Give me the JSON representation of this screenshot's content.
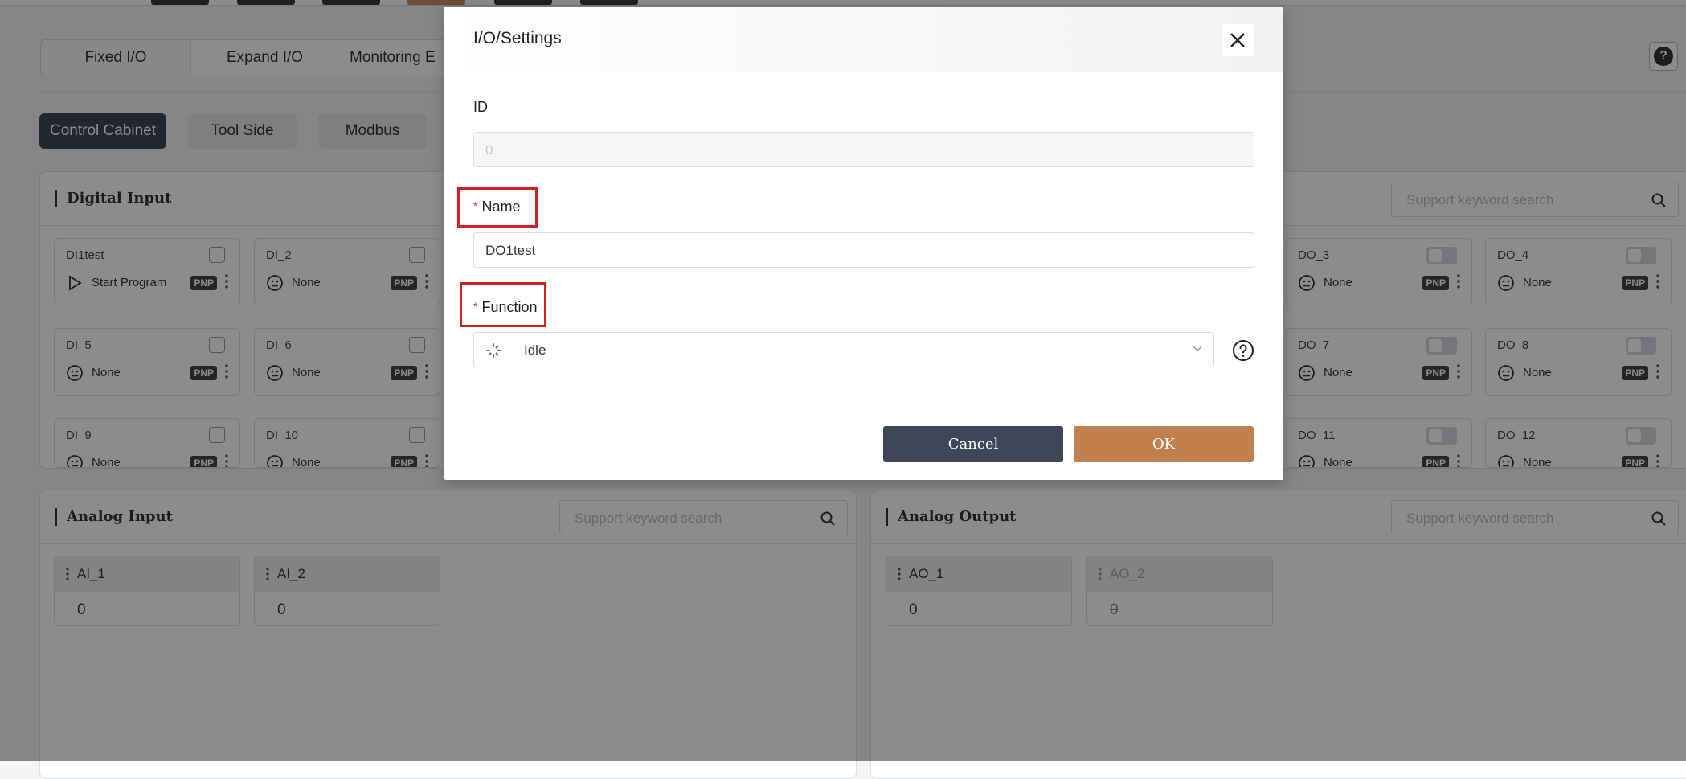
{
  "top_tabs": [
    {
      "label": "Fixed I/O"
    },
    {
      "label": "Expand I/O"
    },
    {
      "label": "Monitoring E"
    }
  ],
  "sub_tabs": [
    {
      "label": "Control Cabinet"
    },
    {
      "label": "Tool Side"
    },
    {
      "label": "Modbus"
    }
  ],
  "digital_input": {
    "title": "Digital Input",
    "cards": [
      {
        "name": "DI1test",
        "function": "Start Program",
        "badge": "PNP"
      },
      {
        "name": "DI_2",
        "function": "None",
        "badge": "PNP"
      },
      {
        "name": "DI_5",
        "function": "None",
        "badge": "PNP"
      },
      {
        "name": "DI_6",
        "function": "None",
        "badge": "PNP"
      },
      {
        "name": "DI_9",
        "function": "None",
        "badge": "PNP"
      },
      {
        "name": "DI_10",
        "function": "None",
        "badge": "PNP"
      }
    ]
  },
  "digital_output": {
    "search_placeholder": "Support keyword search",
    "cards": [
      {
        "name": "DO_3",
        "function": "None",
        "badge": "PNP"
      },
      {
        "name": "DO_4",
        "function": "None",
        "badge": "PNP"
      },
      {
        "name": "DO_7",
        "function": "None",
        "badge": "PNP"
      },
      {
        "name": "DO_8",
        "function": "None",
        "badge": "PNP"
      },
      {
        "name": "DO_11",
        "function": "None",
        "badge": "PNP"
      },
      {
        "name": "DO_12",
        "function": "None",
        "badge": "PNP"
      }
    ]
  },
  "analog_input": {
    "title": "Analog Input",
    "search_placeholder": "Support keyword search",
    "cards": [
      {
        "name": "AI_1",
        "value": "0"
      },
      {
        "name": "AI_2",
        "value": "0"
      }
    ]
  },
  "analog_output": {
    "title": "Analog Output",
    "search_placeholder": "Support keyword search",
    "cards": [
      {
        "name": "AO_1",
        "value": "0"
      },
      {
        "name": "AO_2",
        "value": "0"
      }
    ]
  },
  "modal": {
    "title": "I/O/Settings",
    "id_label": "ID",
    "id_value": "0",
    "required_mark": "*",
    "name_label": "Name",
    "name_value": "DO1test",
    "function_label": "Function",
    "function_value": "Idle",
    "cancel_label": "Cancel",
    "ok_label": "OK"
  },
  "colors": {
    "accent_dark": "#3f4658",
    "accent_orange": "#c0804d",
    "highlight_red": "#d31f1f"
  },
  "icons": {
    "close": "close-icon",
    "help": "question-circle-icon",
    "search": "search-icon",
    "play": "play-icon",
    "none": "neutral-face-icon",
    "idle": "loading-spinner-icon",
    "chevron": "chevron-down-icon"
  }
}
